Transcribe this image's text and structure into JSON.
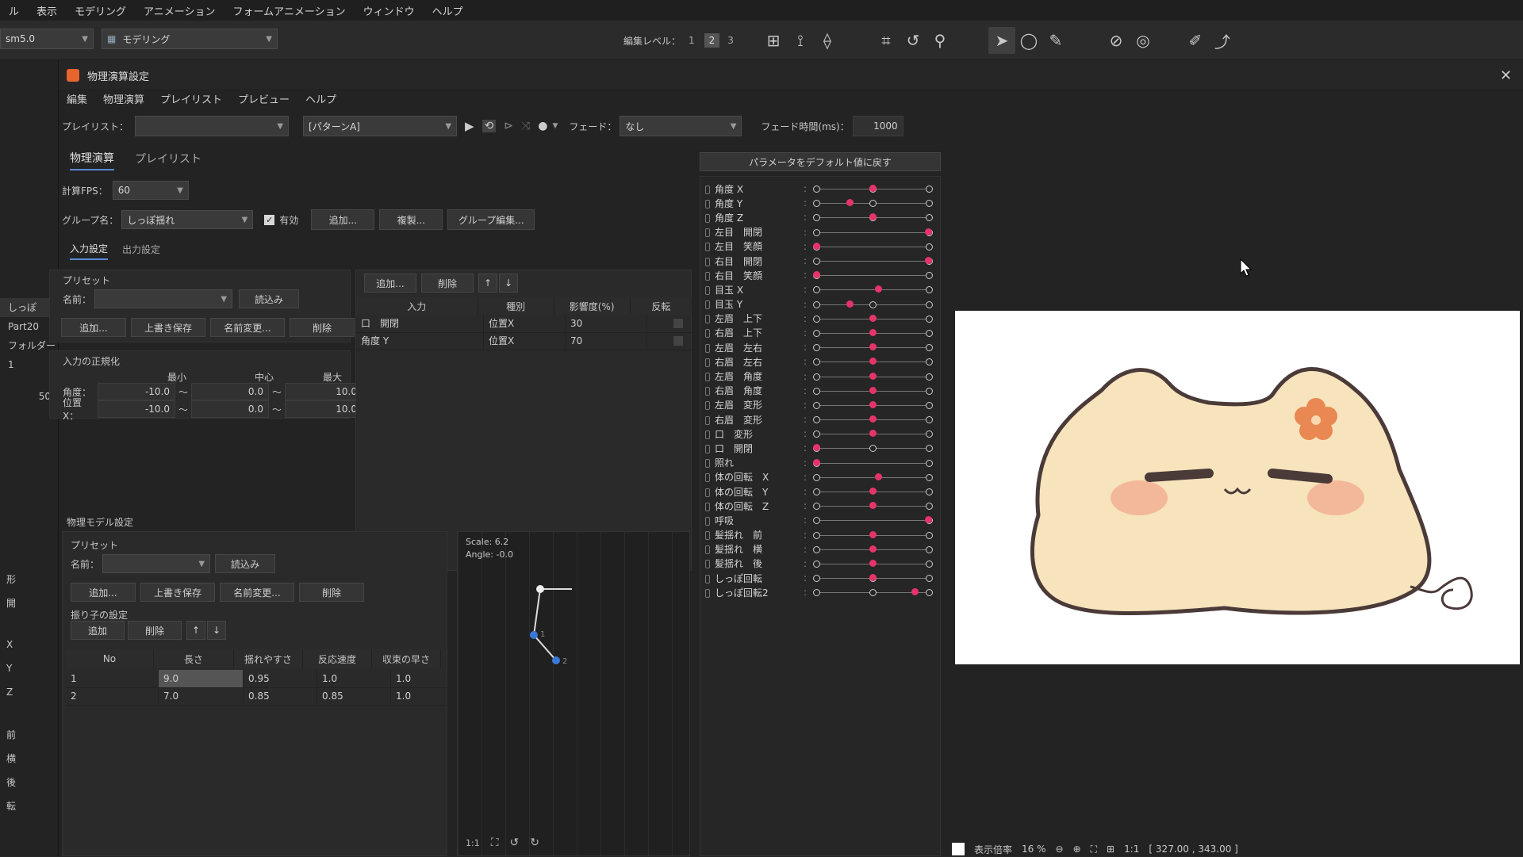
{
  "menubar": [
    "ル",
    "表示",
    "モデリング",
    "アニメーション",
    "フォームアニメーション",
    "ウィンドウ",
    "ヘルプ"
  ],
  "toolbar": {
    "file_combo": "sm5.0",
    "workspace_combo": "モデリング",
    "edit_level_label": "編集レベル：",
    "edit_levels": [
      "1",
      "2",
      "3"
    ],
    "active_level": "2"
  },
  "left_strip": [
    "しっぽ",
    "Part20",
    "フォルダー 1",
    "50",
    "形",
    "開",
    "X",
    "Y",
    "Z",
    "前",
    "横",
    "後",
    "転"
  ],
  "dialog": {
    "title": "物理演算設定",
    "menu": [
      "編集",
      "物理演算",
      "プレイリスト",
      "プレビュー",
      "ヘルプ"
    ],
    "playlist_label": "プレイリスト：",
    "playlist_value": "",
    "pattern_value": "[パターンA]",
    "fade_label": "フェード：",
    "fade_value": "なし",
    "fade_time_label": "フェード時間(ms)：",
    "fade_time_value": "1000",
    "tabs": [
      "物理演算",
      "プレイリスト"
    ],
    "fps_label": "計算FPS：",
    "fps_value": "60",
    "group_label": "グループ名：",
    "group_value": "しっぽ揺れ",
    "enabled_label": "有効",
    "group_buttons": [
      "追加...",
      "複製...",
      "グループ編集..."
    ],
    "subtabs": [
      "入力設定",
      "出力設定"
    ],
    "preset": {
      "title": "プリセット",
      "name_label": "名前：",
      "load": "読込み",
      "buttons": [
        "追加...",
        "上書き保存",
        "名前変更...",
        "削除"
      ]
    },
    "normalize": {
      "title": "入力の正規化",
      "headers": [
        "最小",
        "中心",
        "最大"
      ],
      "rows": [
        {
          "label": "角度：",
          "min": "-10.0",
          "center": "0.0",
          "max": "10.0"
        },
        {
          "label": "位置X：",
          "min": "-10.0",
          "center": "0.0",
          "max": "10.0"
        }
      ],
      "sep": "〜"
    },
    "input_table": {
      "buttons": [
        "追加...",
        "削除",
        "↑",
        "↓"
      ],
      "headers": [
        "入力",
        "種別",
        "影響度(%)",
        "反転"
      ],
      "rows": [
        {
          "input": "口　開閉",
          "type": "位置X",
          "influence": "30"
        },
        {
          "input": "角度 Y",
          "type": "位置X",
          "influence": "70"
        }
      ]
    },
    "physics_model": {
      "title": "物理モデル設定",
      "preset": {
        "title": "プリセット",
        "name_label": "名前：",
        "load": "読込み",
        "buttons": [
          "追加...",
          "上書き保存",
          "名前変更...",
          "削除"
        ]
      },
      "pendulum_title": "振り子の設定",
      "pendulum_buttons": [
        "追加",
        "削除",
        "↑",
        "↓"
      ],
      "headers": [
        "No",
        "長さ",
        "揺れやすさ",
        "反応速度",
        "収束の早さ"
      ],
      "rows": [
        {
          "no": "1",
          "len": "9.0",
          "sway": "0.95",
          "react": "1.0",
          "conv": "1.0"
        },
        {
          "no": "2",
          "len": "7.0",
          "sway": "0.85",
          "react": "0.85",
          "conv": "1.0"
        }
      ],
      "scale": "Scale: 6.2",
      "angle": "Angle: -0.0",
      "node_labels": [
        "1",
        "2"
      ]
    },
    "reset_button": "パラメータをデフォルト値に戻す",
    "params": [
      {
        "label": "角度 X",
        "pos": 0.5,
        "mid": true
      },
      {
        "label": "角度 Y",
        "pos": 0.3,
        "mid": true
      },
      {
        "label": "角度 Z",
        "pos": 0.5,
        "mid": true
      },
      {
        "label": "左目　開閉",
        "pos": 1.0
      },
      {
        "label": "左目　笑顔",
        "pos": 0.0
      },
      {
        "label": "右目　開閉",
        "pos": 1.0
      },
      {
        "label": "右目　笑顔",
        "pos": 0.0
      },
      {
        "label": "目玉 X",
        "pos": 0.55
      },
      {
        "label": "目玉 Y",
        "pos": 0.3,
        "mid": true
      },
      {
        "label": "左眉　上下",
        "pos": 0.5
      },
      {
        "label": "右眉　上下",
        "pos": 0.5
      },
      {
        "label": "左眉　左右",
        "pos": 0.5
      },
      {
        "label": "右眉　左右",
        "pos": 0.5
      },
      {
        "label": "左眉　角度",
        "pos": 0.5
      },
      {
        "label": "右眉　角度",
        "pos": 0.5
      },
      {
        "label": "左眉　変形",
        "pos": 0.5
      },
      {
        "label": "右眉　変形",
        "pos": 0.5
      },
      {
        "label": "口　変形",
        "pos": 0.5
      },
      {
        "label": "口　開閉",
        "pos": 0.0,
        "mid": true
      },
      {
        "label": "照れ",
        "pos": 0.0
      },
      {
        "label": "体の回転　X",
        "pos": 0.55
      },
      {
        "label": "体の回転　Y",
        "pos": 0.5
      },
      {
        "label": "体の回転　Z",
        "pos": 0.5
      },
      {
        "label": "呼吸",
        "pos": 1.0
      },
      {
        "label": "髪揺れ　前",
        "pos": 0.5
      },
      {
        "label": "髪揺れ　横",
        "pos": 0.5
      },
      {
        "label": "髪揺れ　後",
        "pos": 0.5
      },
      {
        "label": "しっぽ回転",
        "pos": 0.5,
        "mid": true
      },
      {
        "label": "しっぽ回転2",
        "pos": 0.88,
        "mid": true
      }
    ]
  },
  "statusbar": {
    "zoom_label": "表示倍率",
    "zoom": "16 %",
    "ratio": "1:1",
    "coords": "[ 327.00 , 343.00 ]"
  },
  "colors": {
    "accent": "#e6336a",
    "blue": "#3a78d8",
    "canvas": "#ffffff",
    "char_fill": "#f7e3bc",
    "blush": "#f3b89a",
    "flower": "#e98852"
  }
}
